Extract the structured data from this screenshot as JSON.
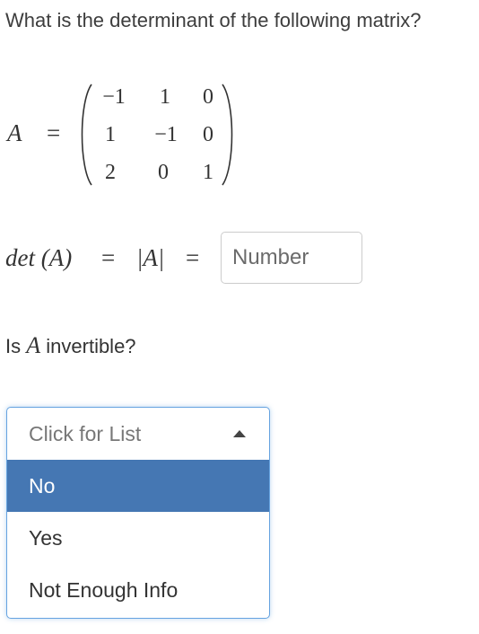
{
  "question": "What is the determinant of the following matrix?",
  "matrix": {
    "label": "A",
    "equals": "=",
    "rows": [
      [
        "−1",
        "1",
        "0"
      ],
      [
        "1",
        "−1",
        "0"
      ],
      [
        "2",
        "0",
        "1"
      ]
    ]
  },
  "determinant": {
    "expression": "det (A)",
    "equals1": "=",
    "abs": "|A|",
    "equals2": "=",
    "input_placeholder": "Number",
    "input_value": ""
  },
  "invertible": {
    "prefix": "Is",
    "var": "A",
    "suffix": "invertible?"
  },
  "dropdown": {
    "placeholder": "Click for List",
    "caret_icon": "caret-up-icon",
    "options": [
      "No",
      "Yes",
      "Not Enough Info"
    ],
    "highlighted_option": "No",
    "highlight_color": "#4577b3",
    "border_color": "#66a3e0"
  }
}
